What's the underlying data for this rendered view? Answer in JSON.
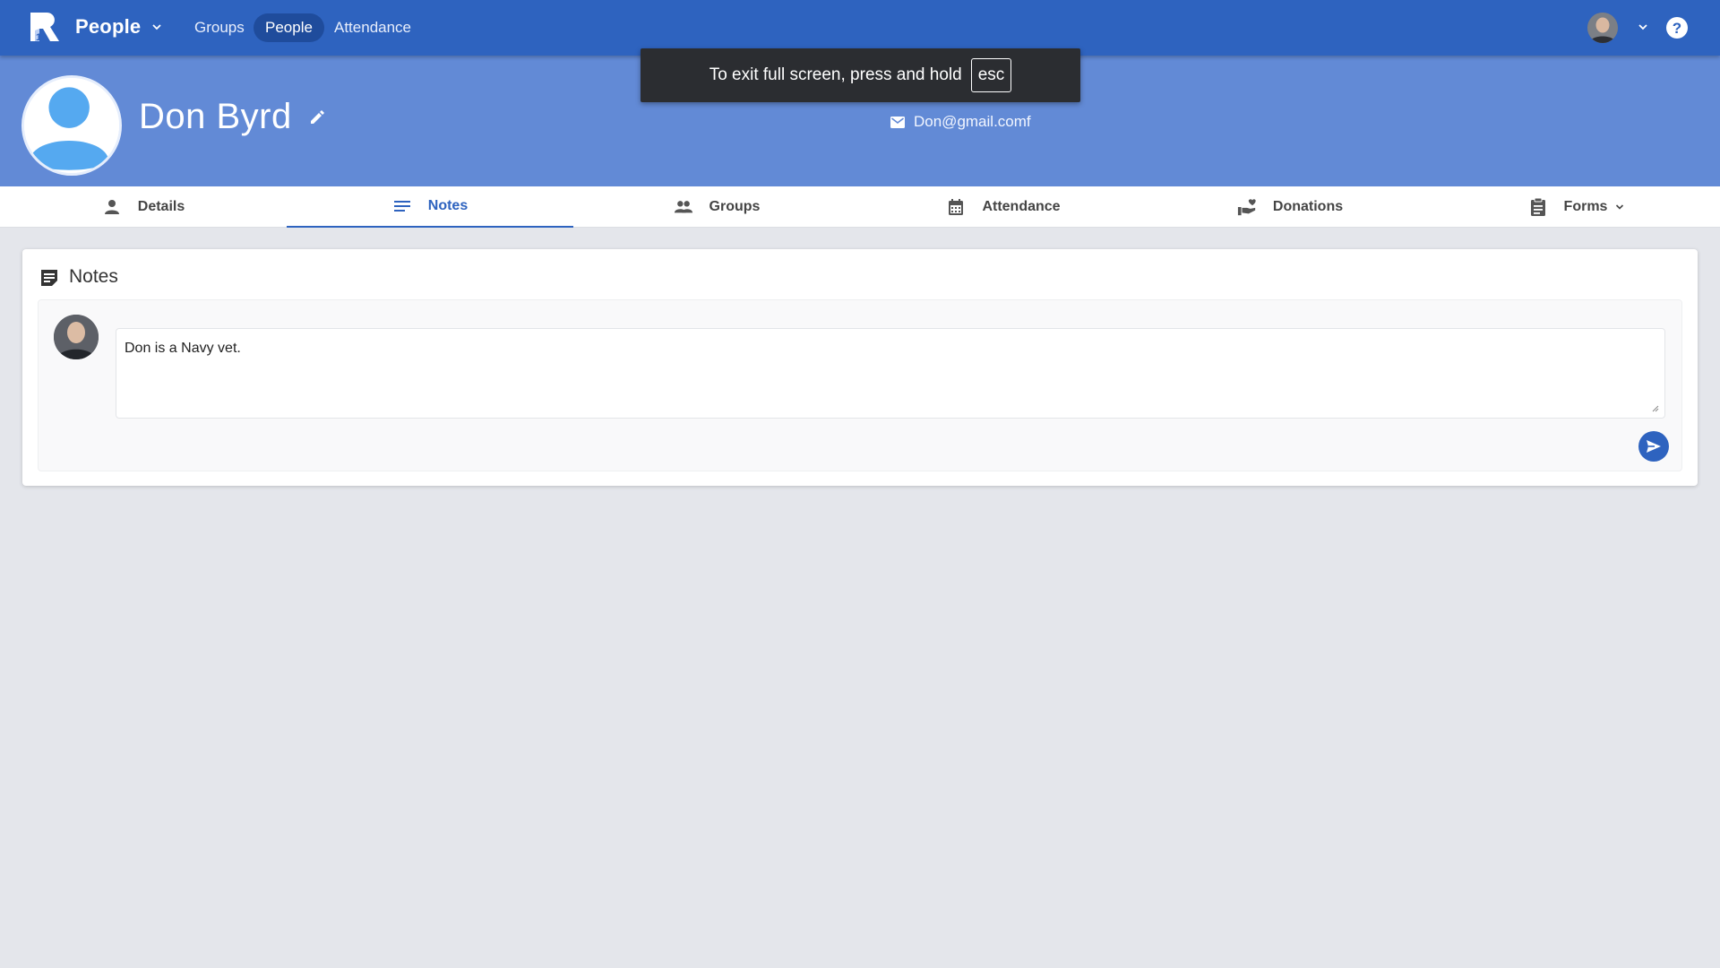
{
  "appbar": {
    "title": "People",
    "nav": [
      {
        "label": "Groups"
      },
      {
        "label": "People",
        "active": true
      },
      {
        "label": "Attendance"
      }
    ],
    "icons": {
      "logo": "brand-logo-icon",
      "help": "help-icon",
      "menu": "chevron-down-icon"
    },
    "color": "#2e63bf"
  },
  "toast": {
    "message": "To exit full screen, press and hold",
    "key": "esc"
  },
  "profile": {
    "name": "Don Byrd",
    "email": "Don@gmail.comf",
    "header_color": "#628ad6"
  },
  "tabs": [
    {
      "label": "Details",
      "icon": "person-icon"
    },
    {
      "label": "Notes",
      "icon": "notes-lines-icon",
      "active": true
    },
    {
      "label": "Groups",
      "icon": "people-icon"
    },
    {
      "label": "Attendance",
      "icon": "calendar-icon"
    },
    {
      "label": "Donations",
      "icon": "donation-hand-icon"
    },
    {
      "label": "Forms",
      "icon": "clipboard-icon",
      "has_menu": true
    }
  ],
  "notes": {
    "title": "Notes",
    "draft_text": "Don is a Navy vet."
  }
}
